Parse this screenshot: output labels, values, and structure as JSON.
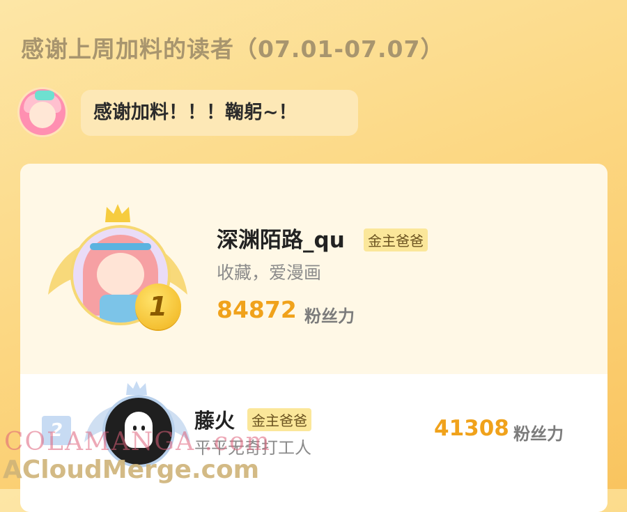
{
  "title": "感谢上周加料的读者（07.01-07.07）",
  "author_message": "感谢加料！！！鞠躬~！",
  "leaderboard": [
    {
      "rank": "1",
      "name": "深渊陌路_qu",
      "tag": "金主爸爸",
      "motto": "收藏，爱漫画",
      "score": "84872",
      "unit": "粉丝力"
    },
    {
      "rank": "2",
      "name": "藤火",
      "tag": "金主爸爸",
      "motto": "平平无奇打工人",
      "score": "41308",
      "unit": "粉丝力"
    }
  ],
  "watermark": {
    "line1": "COLAMANGA .com",
    "line2": "ACloudMerge.com"
  },
  "colors": {
    "accent_orange": "#f0a21b",
    "tag_yellow": "#fbe79a",
    "gold_badge": "#f0b21b",
    "silver_badge": "#c7dbf3"
  }
}
